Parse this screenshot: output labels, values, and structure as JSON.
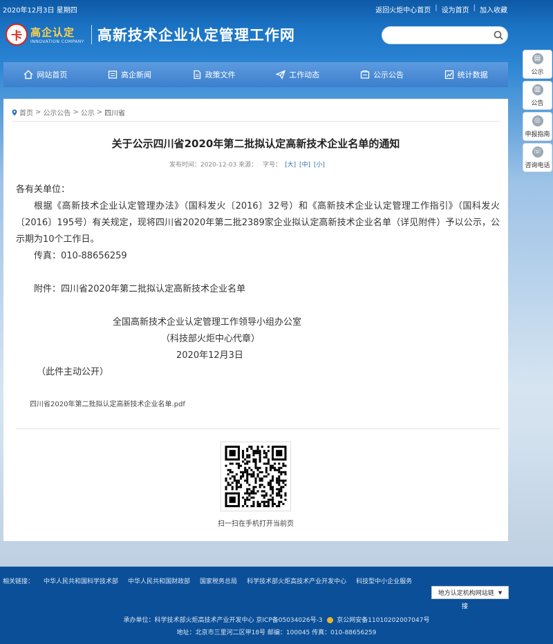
{
  "topbar": {
    "date": "2020年12月3日 星期四",
    "links": [
      "返回火炬中心首页",
      "设为首页",
      "加入收藏"
    ]
  },
  "header": {
    "logo_cn": "高企认定",
    "logo_en": "INNOVATION COMPANY",
    "site_title": "高新技术企业认定管理工作网",
    "search_placeholder": ""
  },
  "nav": {
    "items": [
      {
        "label": "网站首页",
        "icon": "home-icon"
      },
      {
        "label": "高企新闻",
        "icon": "news-icon"
      },
      {
        "label": "政策文件",
        "icon": "document-icon"
      },
      {
        "label": "工作动态",
        "icon": "send-icon"
      },
      {
        "label": "公示公告",
        "icon": "notice-icon"
      },
      {
        "label": "统计数据",
        "icon": "stats-icon"
      }
    ]
  },
  "side": {
    "items": [
      "公示",
      "公告",
      "申报指南",
      "咨询电话"
    ]
  },
  "breadcrumb": {
    "items": [
      "首页",
      "公示公告",
      "公示",
      "四川省"
    ]
  },
  "article": {
    "title": "关于公示四川省2020年第二批拟认定高新技术企业名单的通知",
    "publish_time": "发布时间：2020-12-03 来源：",
    "font_size_label": "字号：",
    "sizes": [
      "[大]",
      "[中]",
      "[小]"
    ],
    "greeting": "各有关单位：",
    "paragraph": "根据《高新技术企业认定管理办法》（国科发火〔2016〕32号）和《高新技术企业认定管理工作指引》（国科发火〔2016〕195号）有关规定，现将四川省2020年第二批2389家企业拟认定高新技术企业名单（详见附件）予以公示，公示期为10个工作日。",
    "fax": "传真：010-88656259",
    "attachment_line": "附件：四川省2020年第二批拟认定高新技术企业名单",
    "signer": "全国高新技术企业认定管理工作领导小组办公室",
    "signer_note": "（科技部火炬中心代章）",
    "date": "2020年12月3日",
    "public_note": "（此件主动公开）",
    "attachment_file": "四川省2020年第二批拟认定高新技术企业名单.pdf",
    "qr_caption": "扫一扫在手机打开当前页"
  },
  "footer": {
    "links": [
      "相关链接：",
      "中华人民共和国科学技术部",
      "中华人民共和国财政部",
      "国家税务总局",
      "科学技术部火炬高技术产业开发中心",
      "科技型中小企业服务"
    ],
    "dropdown_label": "地方认定机构网站链",
    "dropdown_tail": "接",
    "info1_a": "承办单位：科学技术部火炬高技术产业开发中心  京ICP备05034026号-3",
    "info1_b": "京公网安备11010202007047号",
    "info2": "地址：北京市三里河二区甲18号 邮编：100045 传真：010-88656259"
  },
  "colors": {
    "nav": "#3c7fcc",
    "footer": "#0b4f98",
    "link": "#2b6cb0"
  }
}
